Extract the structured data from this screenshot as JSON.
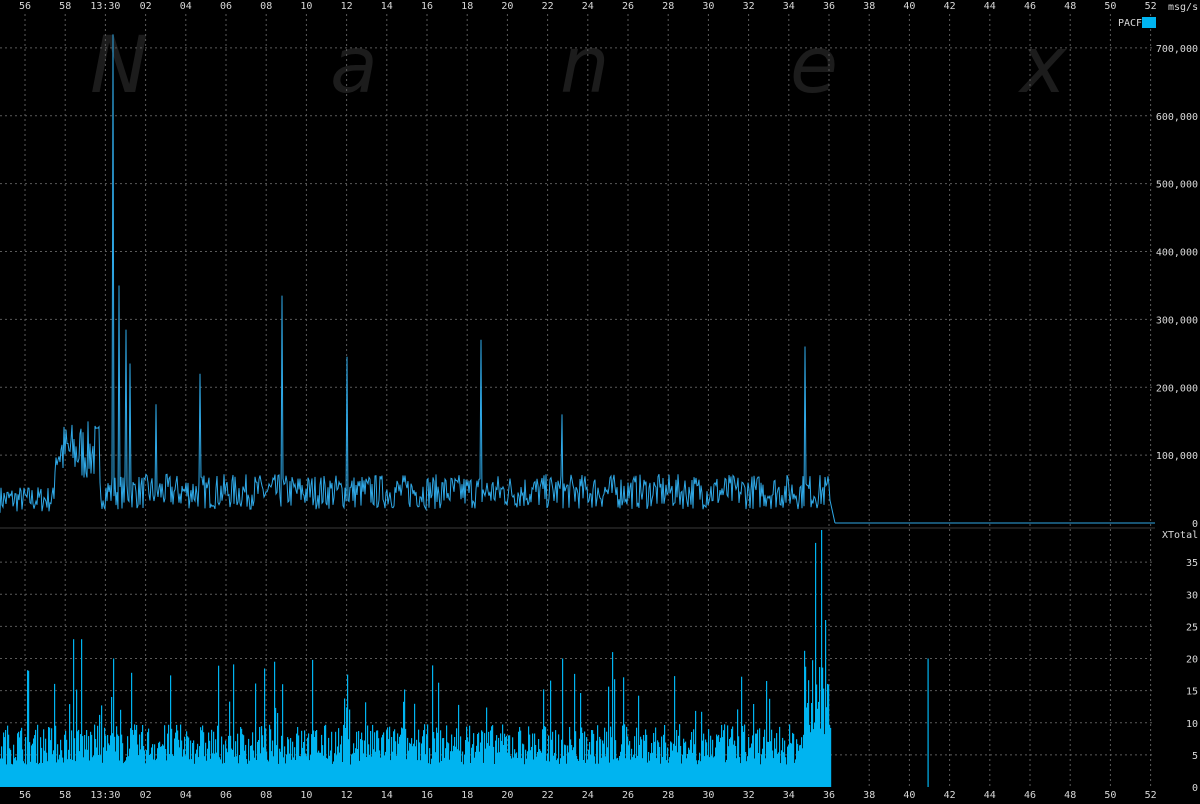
{
  "colors": {
    "background": "#000000",
    "series": "#00b4f0",
    "grid": "#5a5a5a",
    "text": "#d9d9d9",
    "watermark": "#1c1c1c"
  },
  "watermark_letters": [
    "N",
    "a",
    "n",
    "e",
    "x"
  ],
  "x_tick_labels": [
    "56",
    "58",
    "13:30",
    "02",
    "04",
    "06",
    "08",
    "10",
    "12",
    "14",
    "16",
    "18",
    "20",
    "22",
    "24",
    "26",
    "28",
    "30",
    "32",
    "34",
    "36",
    "38",
    "40",
    "42",
    "44",
    "46",
    "48",
    "50",
    "52"
  ],
  "chart_data": [
    {
      "type": "line",
      "ylabel": "msg/s",
      "legend": [
        "PACF"
      ],
      "legend_placement": "top-right",
      "ylim": [
        0,
        750000
      ],
      "y_ticks": [
        0,
        100000,
        200000,
        300000,
        400000,
        500000,
        600000,
        700000
      ],
      "y_tick_labels": [
        "0",
        "100,000",
        "200,000",
        "300,000",
        "400,000",
        "500,000",
        "600,000",
        "700,000"
      ],
      "grid": true,
      "baseline": 45000,
      "baseline_end_minute": 34,
      "spikes": [
        {
          "minute": -1.6,
          "value": 720000
        },
        {
          "minute": -1.6,
          "value": 540000
        },
        {
          "minute": -1.3,
          "value": 350000
        },
        {
          "minute": -1.0,
          "value": 285000
        },
        {
          "minute": -0.8,
          "value": 235000
        },
        {
          "minute": 0.5,
          "value": 175000
        },
        {
          "minute": 2.7,
          "value": 220000
        },
        {
          "minute": 6.8,
          "value": 335000
        },
        {
          "minute": 10.0,
          "value": 245000
        },
        {
          "minute": 16.7,
          "value": 270000
        },
        {
          "minute": 20.7,
          "value": 160000
        },
        {
          "minute": 32.8,
          "value": 260000
        }
      ],
      "after_cutoff_value": 0,
      "grid_values_note": ""
    },
    {
      "type": "bar",
      "ylabel": "XTotal",
      "ylim": [
        0,
        40
      ],
      "y_ticks": [
        0,
        5,
        10,
        15,
        20,
        25,
        30,
        35
      ],
      "y_tick_labels": [
        "0",
        "5",
        "10",
        "15",
        "20",
        "25",
        "30",
        "35"
      ],
      "grid": true,
      "baseline": 7,
      "baseline_end_minute": 34,
      "spikes": [
        {
          "minute": -3.6,
          "value": 23
        },
        {
          "minute": -3.2,
          "value": 23
        },
        {
          "minute": -1.6,
          "value": 20
        },
        {
          "minute": 6.8,
          "value": 16
        },
        {
          "minute": 20.7,
          "value": 20
        },
        {
          "minute": 23.2,
          "value": 21
        },
        {
          "minute": 33.3,
          "value": 38
        },
        {
          "minute": 33.6,
          "value": 40
        },
        {
          "minute": 33.8,
          "value": 26
        },
        {
          "minute": 38.9,
          "value": 20
        }
      ]
    }
  ]
}
